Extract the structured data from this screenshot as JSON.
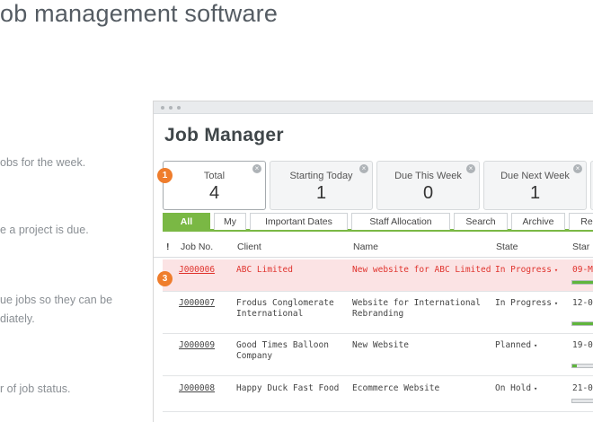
{
  "page": {
    "heading": "ob management software",
    "side_lines": [
      "obs for the week.",
      "e a project is due.",
      "ue jobs so they can be",
      "diately.",
      "r of job status."
    ]
  },
  "app": {
    "title": "Job Manager",
    "stats": [
      {
        "label": "Total",
        "value": "4"
      },
      {
        "label": "Starting Today",
        "value": "1"
      },
      {
        "label": "Due This Week",
        "value": "0"
      },
      {
        "label": "Due Next Week",
        "value": "1"
      }
    ],
    "close_glyph": "×",
    "markers": [
      "1",
      "3"
    ],
    "tabs": [
      "All",
      "My",
      "Important Dates",
      "Staff Allocation",
      "Search",
      "Archive",
      "Re"
    ],
    "columns": [
      "!",
      "Job No.",
      "Client",
      "Name",
      "State",
      "Star"
    ],
    "caret": "▾",
    "jobs": [
      {
        "job_no": "J000006",
        "client": "ABC Limited",
        "client2": "",
        "name": "New website for ABC Limited",
        "name2": "",
        "state": "In Progress",
        "start": "09-M",
        "progress": 0.7,
        "highlight": true
      },
      {
        "job_no": "J000007",
        "client": "Frodus Conglomerate",
        "client2": "International",
        "name": "Website for International",
        "name2": "Rebranding",
        "state": "In Progress",
        "start": "12-0",
        "progress": 0.85,
        "highlight": false
      },
      {
        "job_no": "J000009",
        "client": "Good Times Balloon",
        "client2": "Company",
        "name": "New Website",
        "name2": "",
        "state": "Planned",
        "start": "19-0",
        "progress": 0.12,
        "highlight": false
      },
      {
        "job_no": "J000008",
        "client": "Happy Duck Fast Food",
        "client2": "",
        "name": "Ecommerce Website",
        "name2": "",
        "state": "On Hold",
        "start": "21-0",
        "progress": 0.0,
        "highlight": false
      }
    ]
  }
}
